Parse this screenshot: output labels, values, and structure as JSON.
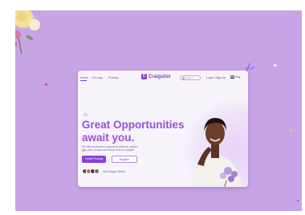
{
  "site": {
    "brand": "Craigslist",
    "nav": [
      "Home",
      "Our app",
      "Posting"
    ],
    "search_placeholder": "Search",
    "login": "Login / Sign Up",
    "language": "Eng"
  },
  "hero": {
    "headline_line1": "Great Opportunities",
    "headline_line2": "await you.",
    "description": "We offer customized organizing solutions, explore gigs, jobs, houses and many more on craiglist.",
    "primary_button": "Create Posting",
    "secondary_button": "Register",
    "happy_clients": "10k Happy Clients"
  },
  "colors": {
    "background": "#c8a4e6",
    "accent": "#8a3fd6",
    "headline": "#9a4fd8"
  }
}
